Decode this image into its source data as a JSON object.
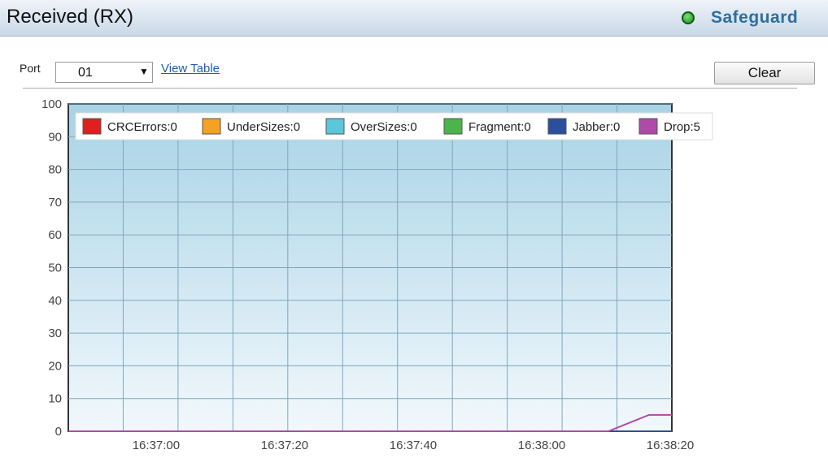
{
  "header": {
    "title": "Received (RX)",
    "status_label": "Safeguard",
    "status_color": "#2e9e2e"
  },
  "controls": {
    "port_label": "Port",
    "port_value": "01",
    "view_table_label": "View Table",
    "clear_label": "Clear"
  },
  "chart_data": {
    "type": "line",
    "ylim": [
      0,
      100
    ],
    "yticks": [
      "0",
      "10",
      "20",
      "30",
      "40",
      "50",
      "60",
      "70",
      "80",
      "90",
      "100"
    ],
    "xticks": [
      "16:37:00",
      "16:37:20",
      "16:37:40",
      "16:38:00",
      "16:38:20"
    ],
    "grid": true,
    "legend_position": "top-left",
    "series": [
      {
        "name": "CRCErrors:0",
        "color": "#e0201e",
        "values": [
          0,
          0,
          0,
          0,
          0,
          0,
          0,
          0,
          0,
          0,
          0,
          0,
          0,
          0,
          0,
          0,
          0,
          0,
          0,
          0
        ]
      },
      {
        "name": "UnderSizes:0",
        "color": "#f4a124",
        "values": [
          0,
          0,
          0,
          0,
          0,
          0,
          0,
          0,
          0,
          0,
          0,
          0,
          0,
          0,
          0,
          0,
          0,
          0,
          0,
          0
        ]
      },
      {
        "name": "OverSizes:0",
        "color": "#5bc7d8",
        "values": [
          0,
          0,
          0,
          0,
          0,
          0,
          0,
          0,
          0,
          0,
          0,
          0,
          0,
          0,
          0,
          0,
          0,
          0,
          0,
          0
        ]
      },
      {
        "name": "Fragment:0",
        "color": "#4bb44b",
        "values": [
          0,
          0,
          0,
          0,
          0,
          0,
          0,
          0,
          0,
          0,
          0,
          0,
          0,
          0,
          0,
          0,
          0,
          0,
          0,
          0
        ]
      },
      {
        "name": "Jabber:0",
        "color": "#2b4f9e",
        "values": [
          0,
          0,
          0,
          0,
          0,
          0,
          0,
          0,
          0,
          0,
          0,
          0,
          0,
          0,
          0,
          0,
          0,
          0,
          0,
          0
        ]
      },
      {
        "name": "Drop:5",
        "color": "#b04aa8",
        "values": [
          0,
          0,
          0,
          0,
          0,
          0,
          0,
          0,
          0,
          0,
          0,
          0,
          0,
          0,
          0,
          0,
          0,
          0,
          5,
          5
        ]
      }
    ]
  }
}
